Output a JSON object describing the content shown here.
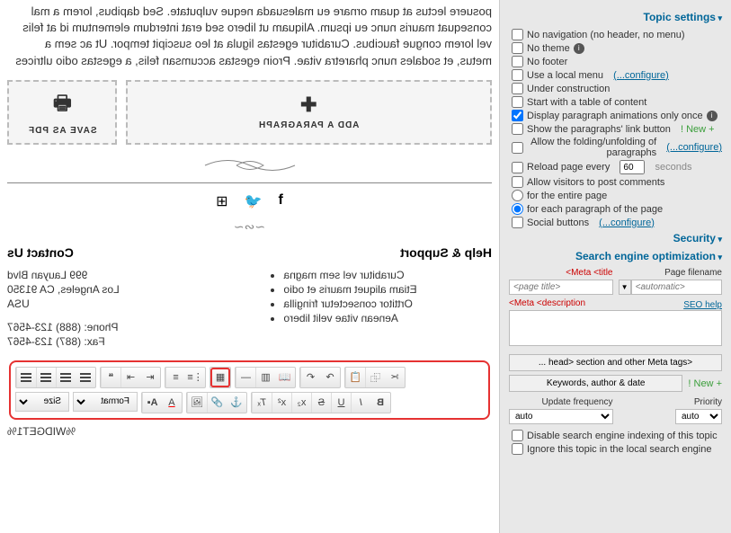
{
  "sidebar": {
    "sections": {
      "topic": "Topic settings",
      "security": "Security",
      "seo": "Search engine optimization"
    },
    "opts": {
      "no_nav": "No navigation (no header, no menu)",
      "no_theme": "No theme",
      "no_footer": "No footer",
      "local_menu": "Use a local menu",
      "configure": "(configure...)",
      "under_construction": "Under construction",
      "start_toc": "Start with a table of content",
      "display_anim": "Display paragraph animations only once",
      "show_link_btn": "Show the paragraphs' link button",
      "new_tag": "+ New !",
      "allow_folding": "Allow the folding/unfolding of paragraphs",
      "reload_every": "Reload page every",
      "reload_val": "60",
      "seconds": "seconds",
      "allow_comments": "Allow visitors to post comments",
      "for_entire": "for the entire page",
      "for_each": "for each paragraph of the page",
      "social_buttons": "Social buttons"
    },
    "seo": {
      "meta_title": "Meta <title>",
      "page_filename": "Page filename",
      "title_ph": "<page title>",
      "filename_ph": "<automatic>",
      "meta_desc": "Meta <description>",
      "seo_help": "SEO help",
      "head_btn": "<head> section and other Meta tags ...",
      "keywords_btn": "Keywords, author & date",
      "update_freq": "Update frequency",
      "priority": "Priority",
      "auto": "auto",
      "disable_index": "Disable search engine indexing of this topic",
      "ignore_local": "Ignore this topic in the local search engine"
    }
  },
  "main": {
    "lorem": "posuere lectus at quam ornare eu malesuada neque vulputate. Sed dapibus, lorem a mal consequat mauris nunc eu ipsum. Aliquam ut libero sed erat interdum elementum id at felis vel lorem congue faucibus. Curabitur egestas ligula at leo suscipit tempor. Ut ac sem a metus, et sodales nunc pharetra vitae. Proin egestas accumsan felis, a egestas odio ultrices",
    "add_para": "ADD A PARAGRAPH",
    "save_pdf": "SAVE AS PDF",
    "contact": {
      "title": "Contact Us",
      "addr1": "999 Lauyan Blvd",
      "addr2": "Los Angeles, CA 91350",
      "addr3": "USA",
      "phone": "Phone: (888) 123-4567",
      "fax": "Fax: (887) 123-4567"
    },
    "help": {
      "title": "Help & Support",
      "items": [
        "Curabitur vel sem magna",
        "Etiam aliquet mauris et odio",
        "Orttitor consectetur fringilla",
        "Aenean vitae velit libero"
      ]
    },
    "widget": "%WIDGET1%",
    "format_label": "Format",
    "size_label": "Size"
  }
}
